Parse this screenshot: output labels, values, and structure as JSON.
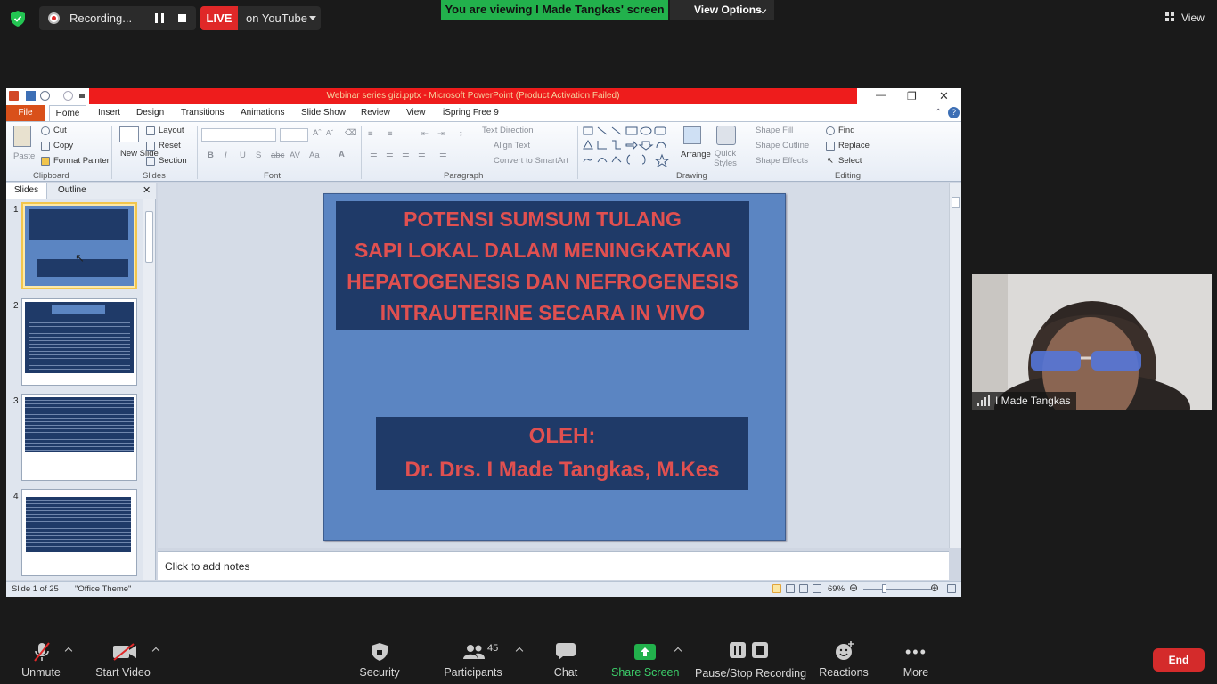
{
  "zoom_top": {
    "recording_label": "Recording...",
    "live_badge": "LIVE",
    "live_target": "on YouTube",
    "viewing_banner": "You are viewing I Made Tangkas' screen",
    "view_options_label": "View Options",
    "view_label": "View"
  },
  "ppt": {
    "window_title": "Webinar series gizi.pptx - Microsoft PowerPoint (Product Activation Failed)",
    "file_tab": "File",
    "tabs": [
      "Home",
      "Insert",
      "Design",
      "Transitions",
      "Animations",
      "Slide Show",
      "Review",
      "View",
      "iSpring Free 9"
    ],
    "clipboard": {
      "paste": "Paste",
      "cut": "Cut",
      "copy": "Copy",
      "format_painter": "Format Painter",
      "label": "Clipboard"
    },
    "slides_group": {
      "new_slide": "New Slide",
      "layout": "Layout",
      "reset": "Reset",
      "section": "Section",
      "label": "Slides"
    },
    "font_group": {
      "label": "Font"
    },
    "paragraph_group": {
      "text_direction": "Text Direction",
      "align_text": "Align Text",
      "convert_smartart": "Convert to SmartArt",
      "label": "Paragraph"
    },
    "drawing_group": {
      "arrange": "Arrange",
      "quick_styles": "Quick Styles",
      "shape_fill": "Shape Fill",
      "shape_outline": "Shape Outline",
      "shape_effects": "Shape Effects",
      "label": "Drawing"
    },
    "editing_group": {
      "find": "Find",
      "replace": "Replace",
      "select": "Select",
      "label": "Editing"
    },
    "pane_tabs": {
      "slides": "Slides",
      "outline": "Outline"
    },
    "slide_numbers": [
      "1",
      "2",
      "3",
      "4"
    ],
    "slide": {
      "title_lines": [
        "POTENSI  SUMSUM TULANG",
        "SAPI LOKAL DALAM MENINGKATKAN",
        "HEPATOGENESIS DAN NEFROGENESIS",
        "INTRAUTERINE SECARA IN VIVO"
      ],
      "oleh": "OLEH:",
      "author": "Dr. Drs. I Made Tangkas, M.Kes"
    },
    "notes_placeholder": "Click to add notes",
    "status": {
      "slide_of": "Slide 1 of 25",
      "theme": "\"Office Theme\"",
      "zoom": "69%"
    }
  },
  "video": {
    "participant_name": "I Made Tangkas"
  },
  "toolbar": {
    "unmute": "Unmute",
    "start_video": "Start Video",
    "security": "Security",
    "participants": "Participants",
    "participants_count": "45",
    "chat": "Chat",
    "share_screen": "Share Screen",
    "pause_stop_recording": "Pause/Stop Recording",
    "reactions": "Reactions",
    "more": "More",
    "end": "End"
  },
  "colors": {
    "live_red": "#e02828",
    "share_green": "#22b14c",
    "slide_blue": "#5b85c2",
    "slide_title_red": "#e05050",
    "title_box_navy": "#1f3a68"
  }
}
